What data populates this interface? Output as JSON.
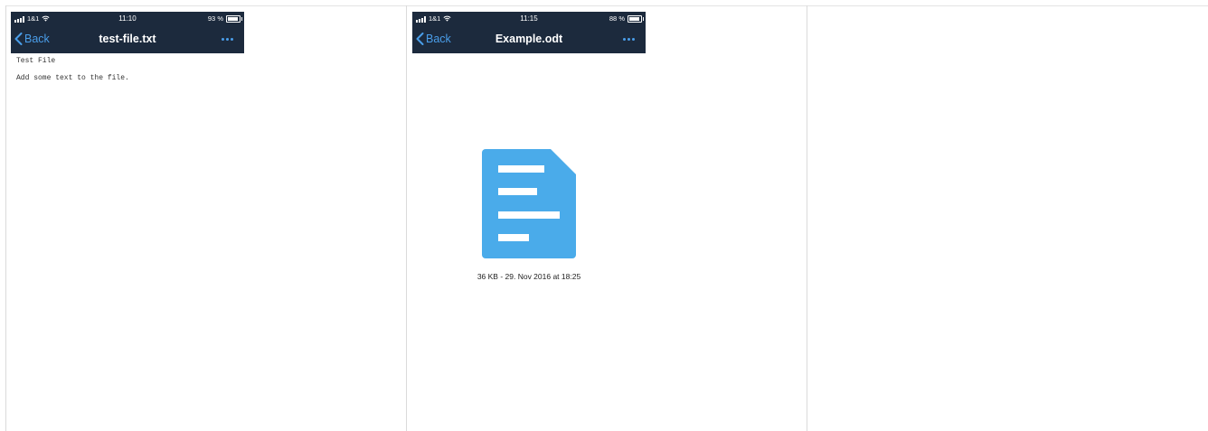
{
  "screens": [
    {
      "status": {
        "carrier": "1&1",
        "time": "11:10",
        "battery": "93 %",
        "battery_level": 0.93
      },
      "nav": {
        "back_label": "Back",
        "title": "test-file.txt"
      },
      "content": {
        "lines": [
          "Test File",
          "Add some text to the file."
        ]
      }
    },
    {
      "status": {
        "carrier": "1&1",
        "time": "11:15",
        "battery": "88 %",
        "battery_level": 0.88
      },
      "nav": {
        "back_label": "Back",
        "title": "Example.odt"
      },
      "file": {
        "icon": "document-icon",
        "info": "36 KB - 29. Nov 2016 at 18:25"
      }
    }
  ],
  "colors": {
    "header_bg": "#1c2a3d",
    "accent": "#4a9eea",
    "doc_icon": "#4aabea"
  }
}
